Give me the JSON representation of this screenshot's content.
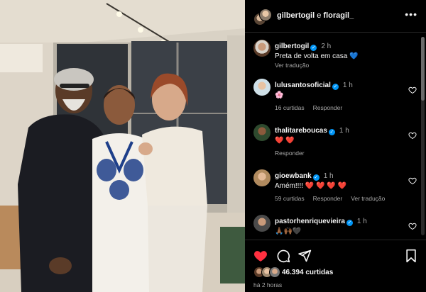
{
  "header": {
    "user_a": "gilbertogil",
    "separator": "e",
    "user_b": "floragil_",
    "more_label": "•••"
  },
  "caption": {
    "user": "gilbertogil",
    "time": "2 h",
    "text": "Preta de volta em casa 💙",
    "translate": "Ver tradução"
  },
  "comments": [
    {
      "user": "lulusantosoficial",
      "verified": true,
      "time": "1 h",
      "text": "🌸",
      "likes": "16 curtidas",
      "reply": "Responder",
      "translate": ""
    },
    {
      "user": "thalitareboucas",
      "verified": true,
      "time": "1 h",
      "text": "❤️ ❤️",
      "likes": "",
      "reply": "Responder",
      "translate": ""
    },
    {
      "user": "gioewbank",
      "verified": true,
      "time": "1 h",
      "text": "Amém!!!! ❤️ ❤️ ❤️ ❤️",
      "likes": "59 curtidas",
      "reply": "Responder",
      "translate": "Ver tradução"
    },
    {
      "user": "pastorhenriquevieira",
      "verified": true,
      "time": "1 h",
      "text": "🙏🏾🙌🏾🖤",
      "likes": "",
      "reply": "",
      "translate": ""
    }
  ],
  "footer": {
    "likes": "46.394 curtidas",
    "time_ago": "há 2 horas"
  },
  "icons": {
    "like": "heart-filled-icon",
    "comment": "comment-icon",
    "share": "share-icon",
    "save": "bookmark-icon",
    "verified": "verified-badge-icon"
  },
  "colors": {
    "like_red": "#ff3040",
    "verified_blue": "#0095f6",
    "muted": "#a8a8a8",
    "background": "#000000"
  }
}
